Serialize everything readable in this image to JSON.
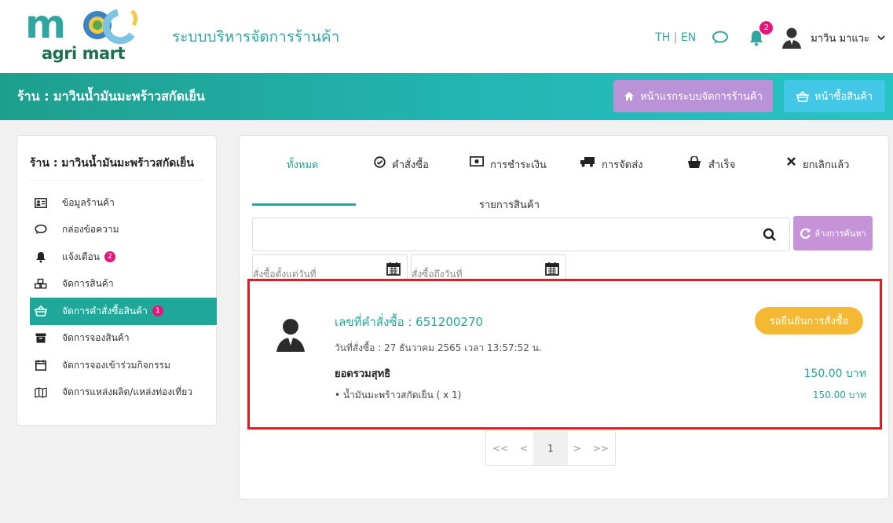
{
  "header": {
    "logo_text": "mcc",
    "logo_sub": "agri mart",
    "system_title": "ระบบบริหารจัดการร้านค้า",
    "lang_th": "TH",
    "lang_sep": "|",
    "lang_en": "EN",
    "notification_count": "2",
    "user_name": "มาวิน มาแวะ"
  },
  "banner": {
    "shop_title": "ร้าน : มาวินน้ำมันมะพร้าวสกัดเย็น",
    "admin_button": "หน้าแรกระบบจัดการร้านค้า",
    "shop_button": "หน้าซื้อสินค้า"
  },
  "sidebar": {
    "title": "ร้าน : มาวินน้ำมันมะพร้าวสกัดเย็น",
    "items": [
      {
        "label": "ข้อมูลร้านค้า",
        "icon": "id-card-icon"
      },
      {
        "label": "กล่องข้อความ",
        "icon": "chat-icon"
      },
      {
        "label": "แจ้งเตือน",
        "icon": "bell-icon",
        "badge": "2"
      },
      {
        "label": "จัดการสินค้า",
        "icon": "cubes-icon"
      },
      {
        "label": "จัดการคำสั่งซื้อสินค้า",
        "icon": "basket-icon",
        "badge": "1",
        "active": true
      },
      {
        "label": "จัดการจองสินค้า",
        "icon": "archive-icon"
      },
      {
        "label": "จัดการจองเข้าร่วมกิจกรรม",
        "icon": "calendar-icon"
      },
      {
        "label": "จัดการแหล่งผลิต/แหล่งท่องเที่ยว",
        "icon": "map-icon"
      }
    ]
  },
  "tabs": {
    "all": "ทั้งหมด",
    "order": "คำสั่งซื้อ",
    "payment": "การชำระเงิน",
    "payment_sub": "รายการสินค้า",
    "shipping": "การจัดส่ง",
    "done": "สำเร็จ",
    "cancelled": "ยกเลิกแล้ว"
  },
  "search": {
    "placeholder": "",
    "clear_label": "ล้างการค้นหา",
    "date_from": "สั่งซื้อตั้งแต่วันที่",
    "date_to": "สั่งซื้อถึงวันที่"
  },
  "order": {
    "number": "เลขที่คำสั่งซื้อ : 651200270",
    "date": "วันที่สั่งซื้อ : 27 ธันวาคม 2565 เวลา 13:57:52 น.",
    "status": "รอยืนยันการสั่งซื้อ",
    "net_label": "ยอดรวมสุทธิ",
    "net_value": "150.00 บาท",
    "item": "• น้ำมันมะพร้าวสกัดเย็น ( x 1)",
    "item_price": "150.00 บาท"
  },
  "pager": {
    "first": "<<",
    "prev": "<",
    "current": "1",
    "next": ">",
    "last": ">>"
  },
  "colors": {
    "teal": "#1fa89a",
    "purple": "#b992d7",
    "cyan": "#42c8e6",
    "pink_badge": "#e6157a",
    "status_yellow": "#f5b832",
    "highlight_red": "#e01d1d"
  }
}
